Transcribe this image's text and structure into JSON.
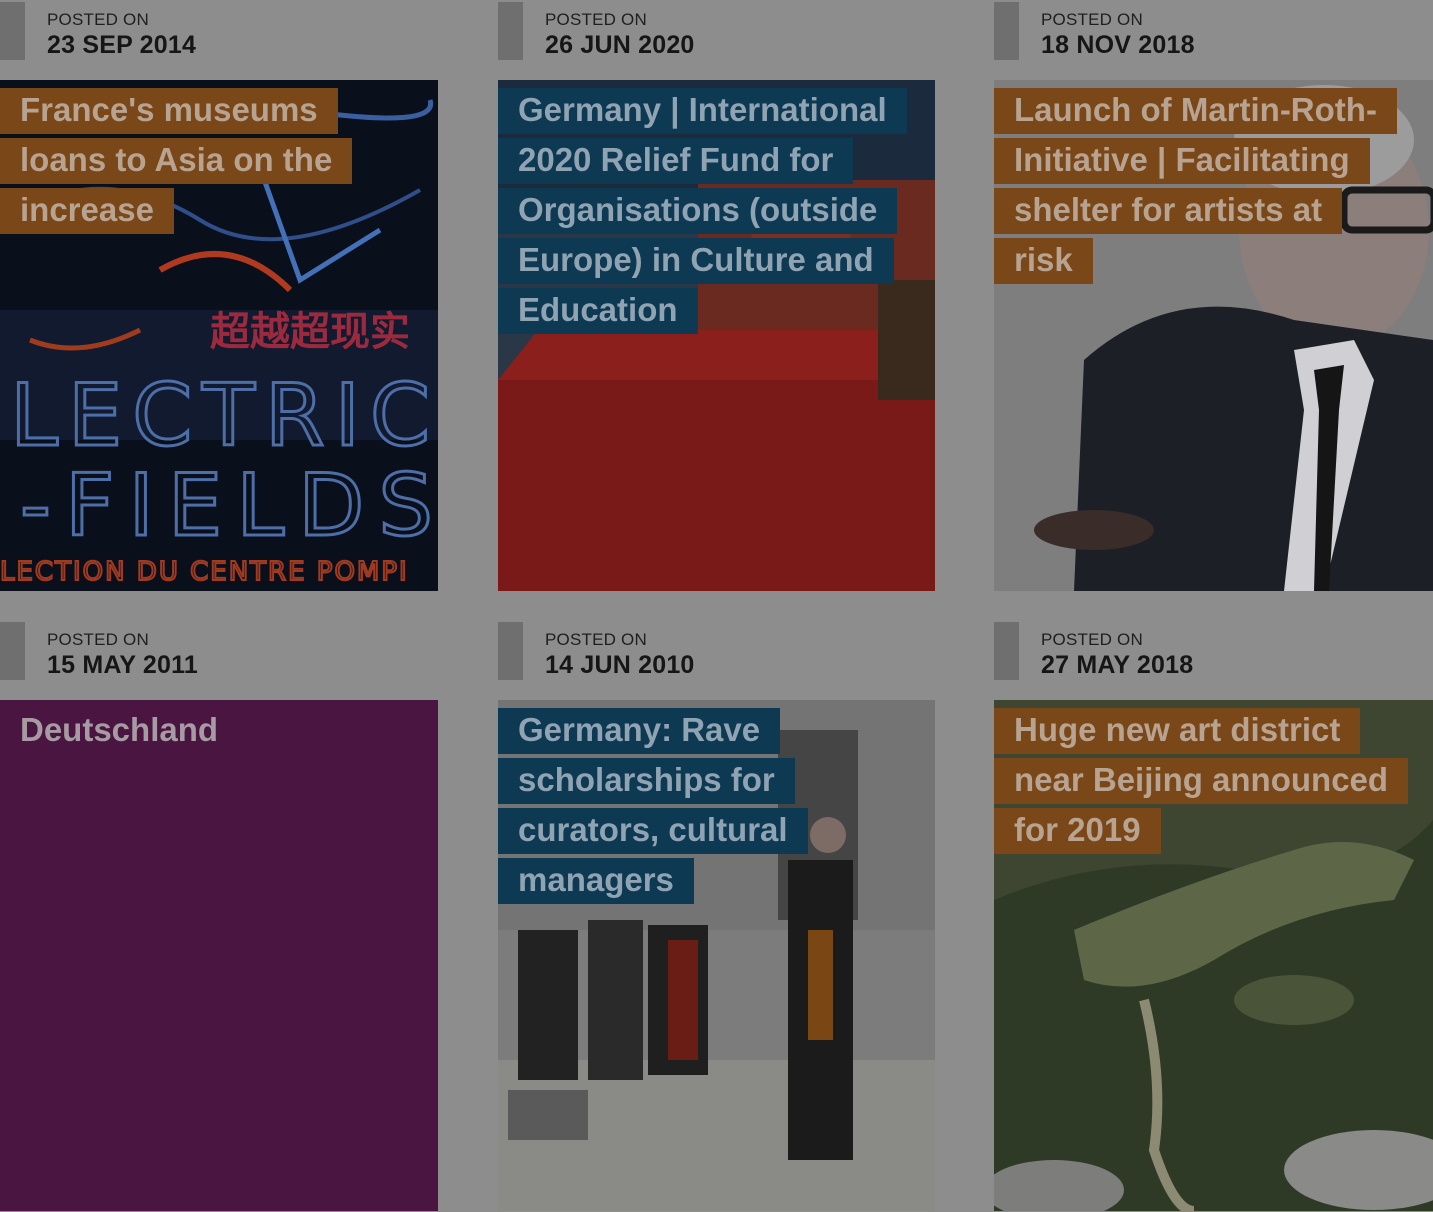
{
  "posts": [
    {
      "posted_label": "POSTED ON",
      "date": "23 SEP 2014",
      "title": "France's museums loans to Asia on the increase",
      "image_text": {
        "line1": "超越超现实",
        "line2": "LECTRIC",
        "line3": "-FIELDS",
        "line4": "LECTION DU CENTRE POMPI"
      }
    },
    {
      "posted_label": "POSTED ON",
      "date": "26 JUN 2020",
      "title": "Germany | International 2020 Relief Fund for Organisations (outside Europe) in Culture and Education"
    },
    {
      "posted_label": "POSTED ON",
      "date": "18 NOV 2018",
      "title": "Launch of Martin-Roth-Initiative | Facilitating shelter for artists at risk"
    },
    {
      "posted_label": "POSTED ON",
      "date": "15 MAY 2011",
      "title": "Deutschland"
    },
    {
      "posted_label": "POSTED ON",
      "date": "14 JUN 2010",
      "title": "Germany: Rave scholarships for curators, cultural managers"
    },
    {
      "posted_label": "POSTED ON",
      "date": "27 MAY 2018",
      "title": "Huge new art district near Beijing announced for 2019"
    }
  ],
  "colors": {
    "page_background": "#8d8d8d",
    "orange_label": "#7a4719",
    "blue_label": "#0d3953",
    "purple_tile": "#4a1540"
  }
}
